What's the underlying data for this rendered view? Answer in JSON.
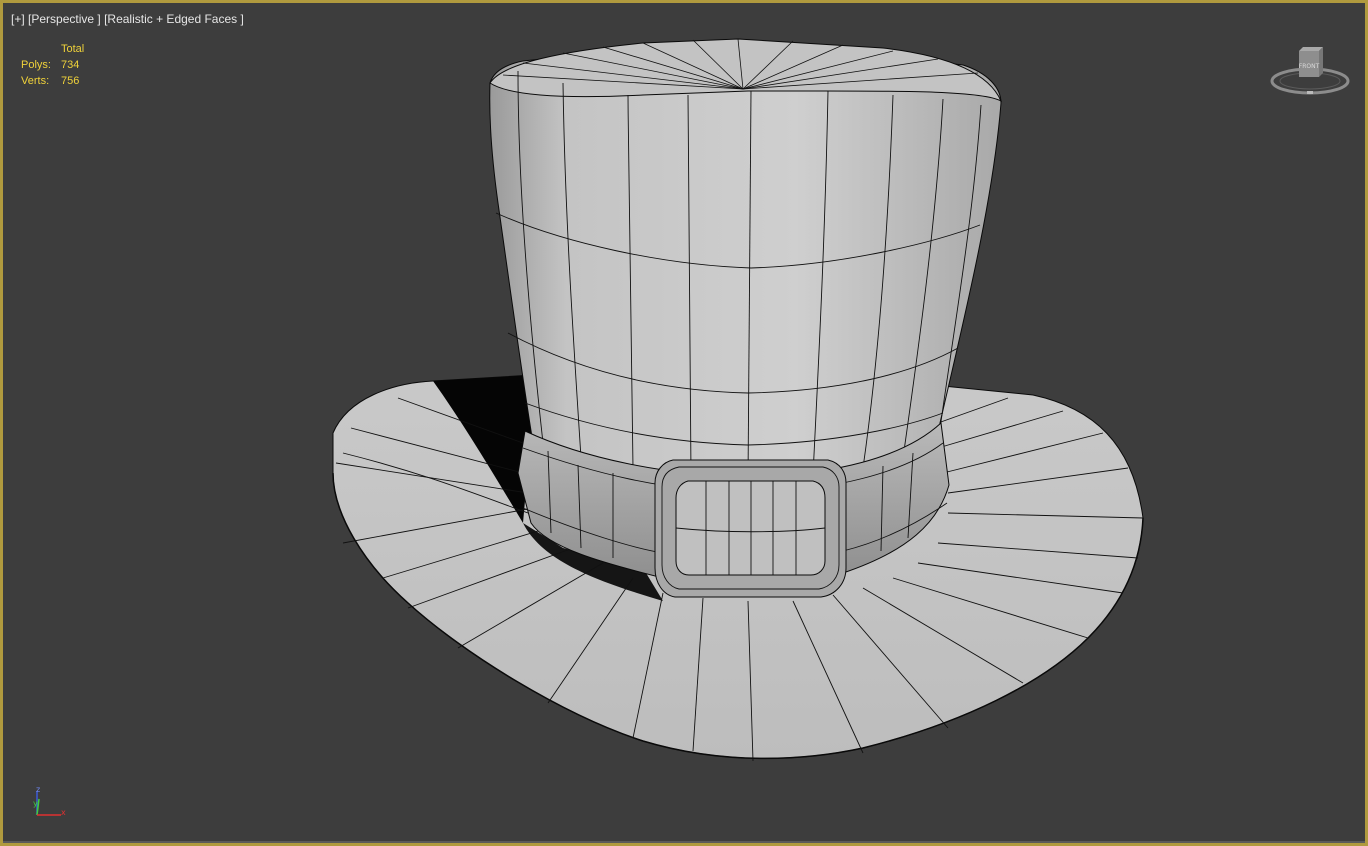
{
  "viewport": {
    "label_plus": "[+]",
    "label_view": "[Perspective ]",
    "label_shading": "[Realistic + Edged Faces ]",
    "border_color": "#b09a3e",
    "background_color": "#3d3d3d"
  },
  "stats": {
    "header": "Total",
    "polys_label": "Polys:",
    "polys_value": "734",
    "verts_label": "Verts:",
    "verts_value": "756",
    "text_color": "#f0d23a"
  },
  "viewcube": {
    "face_label": "FRONT",
    "icon": "viewcube-icon"
  },
  "axis_tripod": {
    "z": "z",
    "y": "y",
    "x": "x",
    "icon": "axis-tripod-icon"
  },
  "model": {
    "icon": "top-hat-mesh",
    "fill_color": "#b4b4b4",
    "edge_color": "#0a0a0a"
  }
}
